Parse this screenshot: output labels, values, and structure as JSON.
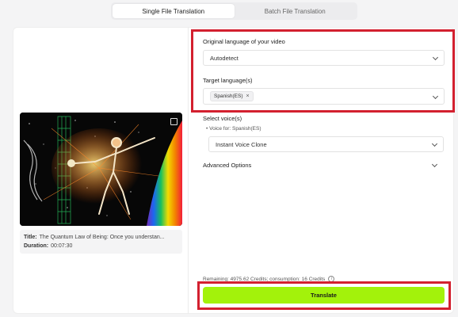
{
  "tabs": [
    {
      "label": "Single File Translation",
      "active": true
    },
    {
      "label": "Batch File Translation",
      "active": false
    }
  ],
  "video": {
    "title_label": "Title:",
    "title_value": "The Quantum Law of Being: Once you understan...",
    "duration_label": "Duration:",
    "duration_value": "00:07:30"
  },
  "form": {
    "original_language_label": "Original language of your video",
    "original_language_value": "Autodetect",
    "target_language_label": "Target language(s)",
    "target_language_chips": [
      "Spanish(ES)"
    ],
    "select_voice_label": "Select voice(s)",
    "voice_for_label": "Voice for: Spanish(ES)",
    "voice_value": "Instant Voice Clone",
    "advanced_options_label": "Advanced Options"
  },
  "footer": {
    "credits_text": "Remaining: 4975.62 Credits; consumption: 16 Credits",
    "info_icon": "i",
    "translate_label": "Translate"
  },
  "colors": {
    "accent_button": "#a3f20b",
    "highlight_border": "#d3202f"
  }
}
